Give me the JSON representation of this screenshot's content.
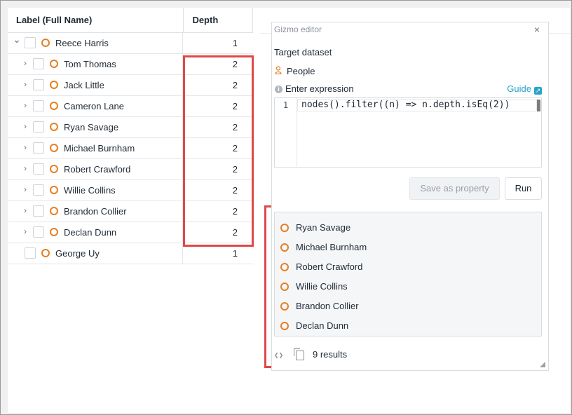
{
  "table": {
    "headers": {
      "label": "Label (Full Name)",
      "depth": "Depth"
    },
    "rows": [
      {
        "name": "Reece Harris",
        "depth": "1",
        "expanded": true,
        "level": 0
      },
      {
        "name": "Tom Thomas",
        "depth": "2",
        "expanded": false,
        "level": 1
      },
      {
        "name": "Jack Little",
        "depth": "2",
        "expanded": false,
        "level": 1
      },
      {
        "name": "Cameron Lane",
        "depth": "2",
        "expanded": false,
        "level": 1
      },
      {
        "name": "Ryan Savage",
        "depth": "2",
        "expanded": false,
        "level": 1
      },
      {
        "name": "Michael Burnham",
        "depth": "2",
        "expanded": false,
        "level": 1
      },
      {
        "name": "Robert Crawford",
        "depth": "2",
        "expanded": false,
        "level": 1
      },
      {
        "name": "Willie Collins",
        "depth": "2",
        "expanded": false,
        "level": 1
      },
      {
        "name": "Brandon Collier",
        "depth": "2",
        "expanded": false,
        "level": 1
      },
      {
        "name": "Declan Dunn",
        "depth": "2",
        "expanded": false,
        "level": 1
      },
      {
        "name": "George Uy",
        "depth": "1",
        "expanded": null,
        "level": 0
      }
    ]
  },
  "editor": {
    "title": "Gizmo editor",
    "close": "×",
    "target_label": "Target dataset",
    "dataset": "People",
    "expression_label": "Enter expression",
    "guide_label": "Guide",
    "code_line_number": "1",
    "code": "nodes().filter((n) => n.depth.isEq(2))",
    "save_label": "Save as property",
    "run_label": "Run",
    "results": [
      "Ryan Savage",
      "Michael Burnham",
      "Robert Crawford",
      "Willie Collins",
      "Brandon Collier",
      "Declan Dunn"
    ],
    "results_count": "9 results"
  },
  "colors": {
    "node": "#e67e22",
    "highlight": "#e04848",
    "link": "#2aa3c9"
  }
}
